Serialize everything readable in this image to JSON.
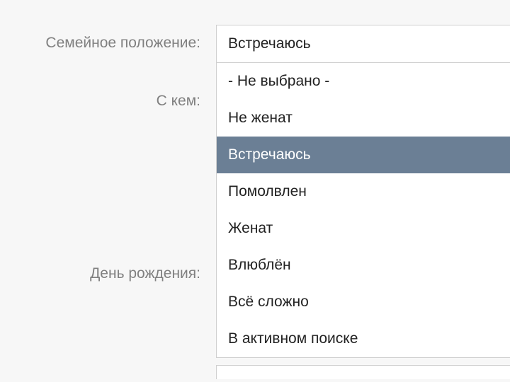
{
  "form": {
    "marital_status_label": "Семейное положение:",
    "with_whom_label": "С кем:",
    "birthday_label": "День рождения:"
  },
  "dropdown": {
    "selected_value": "Встречаюсь",
    "selected_index": 2,
    "options": [
      "- Не выбрано -",
      "Не женат",
      "Встречаюсь",
      "Помолвлен",
      "Женат",
      "Влюблён",
      "Всё сложно",
      "В активном поиске"
    ]
  }
}
